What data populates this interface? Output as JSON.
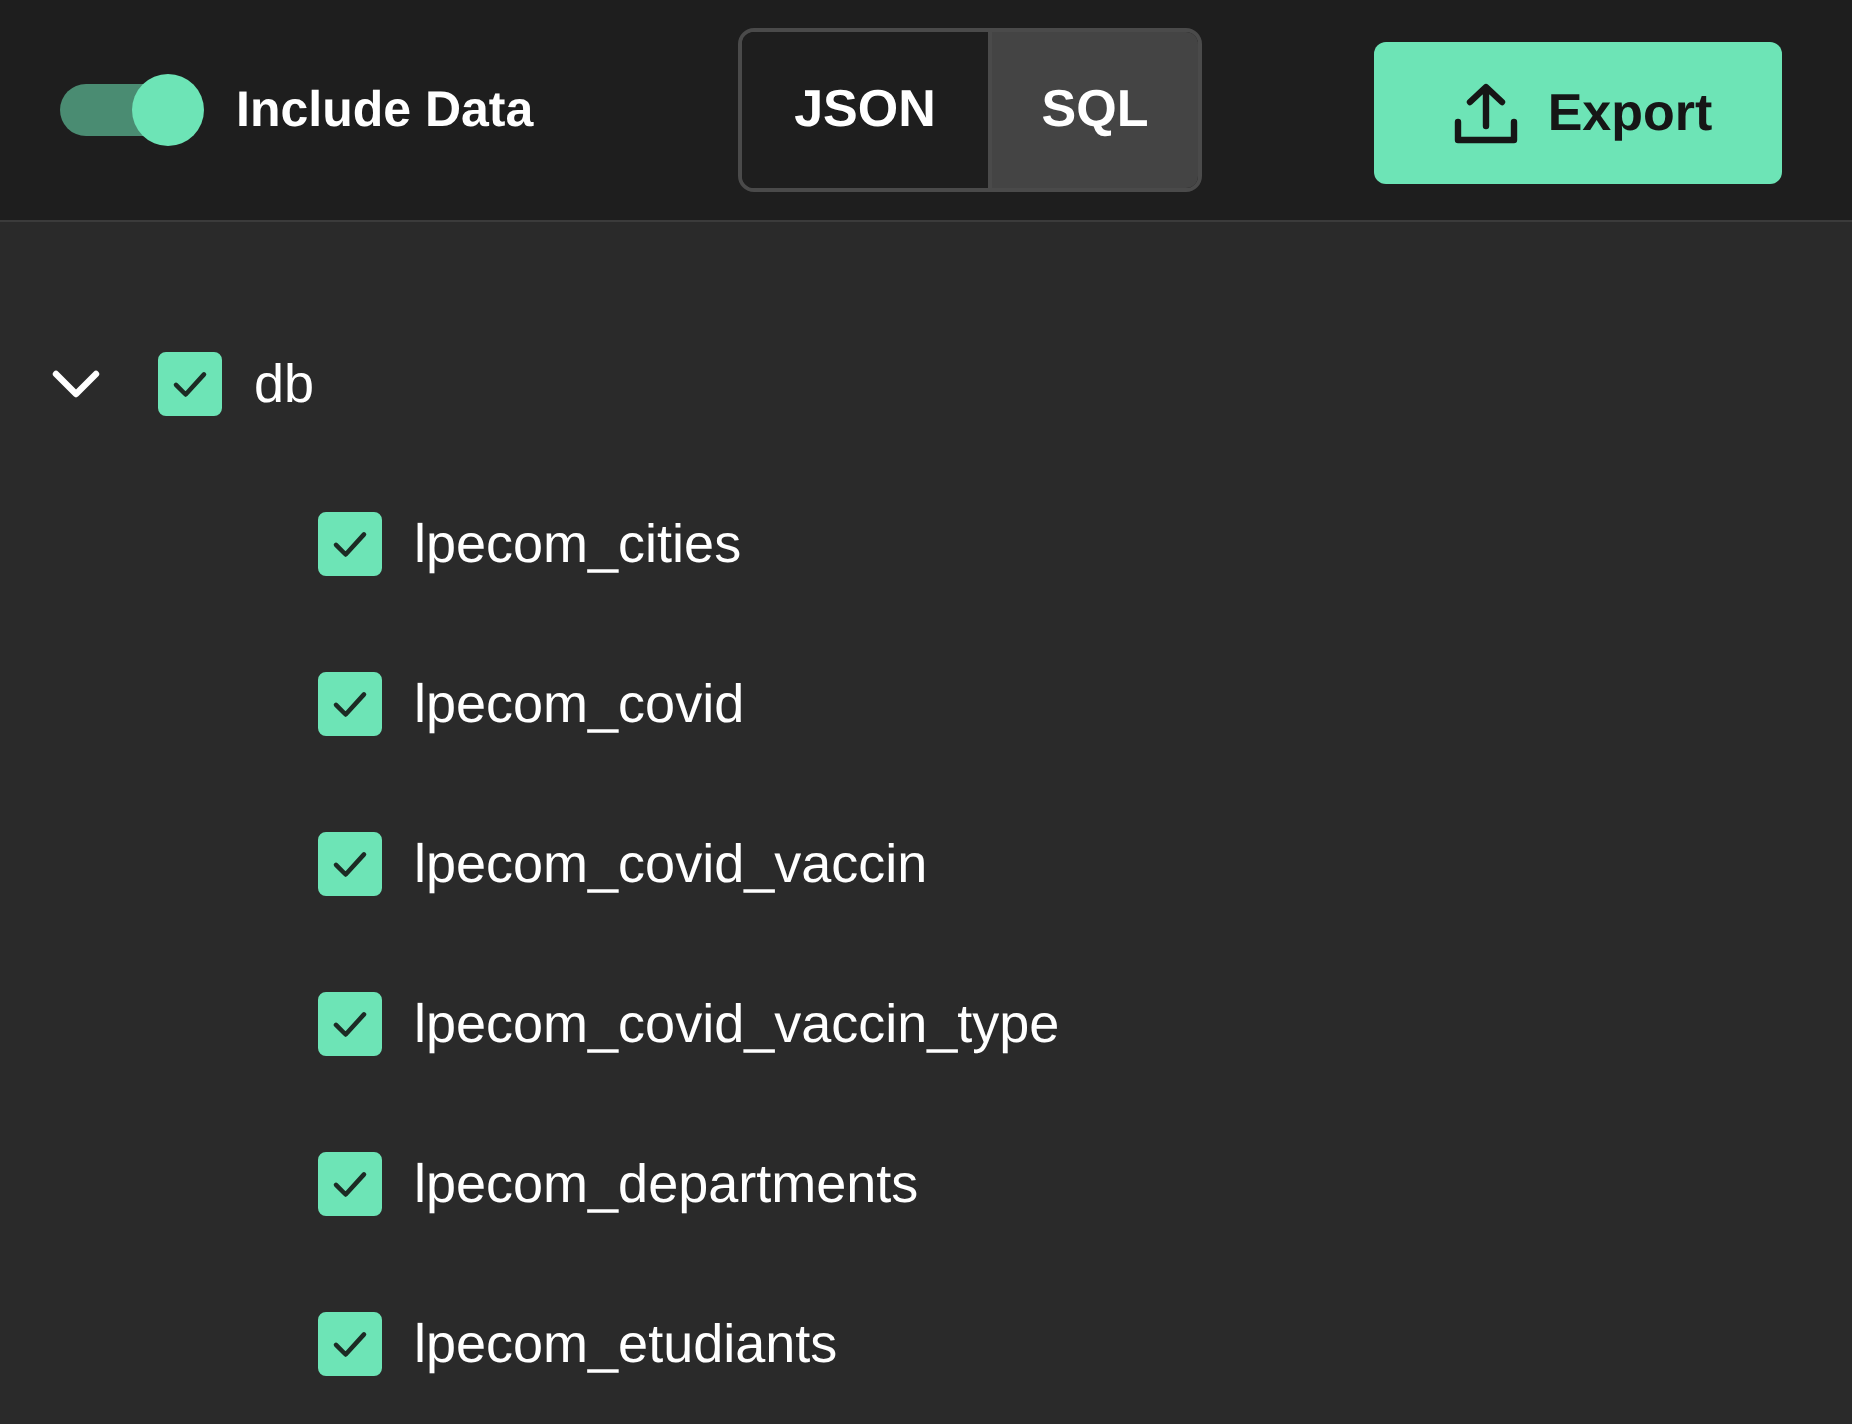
{
  "toolbar": {
    "include_data": {
      "label": "Include Data",
      "on": true
    },
    "formats": [
      {
        "label": "JSON",
        "selected": false
      },
      {
        "label": "SQL",
        "selected": true
      }
    ],
    "export_button": {
      "label": "Export"
    }
  },
  "tree": [
    {
      "label": "db",
      "checked": true,
      "expanded": true,
      "children": [
        {
          "label": "lpecom_cities",
          "checked": true
        },
        {
          "label": "lpecom_covid",
          "checked": true
        },
        {
          "label": "lpecom_covid_vaccin",
          "checked": true
        },
        {
          "label": "lpecom_covid_vaccin_type",
          "checked": true
        },
        {
          "label": "lpecom_departments",
          "checked": true
        },
        {
          "label": "lpecom_etudiants",
          "checked": true
        }
      ]
    }
  ]
}
